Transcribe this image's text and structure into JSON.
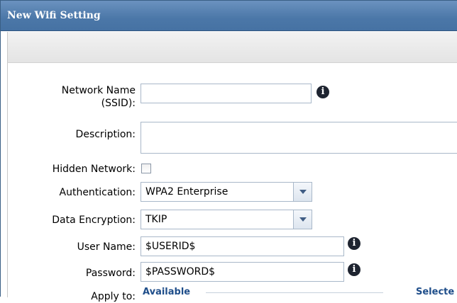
{
  "window": {
    "title": "New Wifi Setting"
  },
  "form": {
    "network_name": {
      "label": "Network Name",
      "label_line2": "(SSID):",
      "value": ""
    },
    "description": {
      "label": "Description:",
      "value": ""
    },
    "hidden_network": {
      "label": "Hidden Network:",
      "checked": false
    },
    "authentication": {
      "label": "Authentication:",
      "value": "WPA2 Enterprise"
    },
    "data_encryption": {
      "label": "Data Encryption:",
      "value": "TKIP"
    },
    "user_name": {
      "label": "User Name:",
      "value": "$USERID$"
    },
    "password": {
      "label": "Password:",
      "value": "$PASSWORD$"
    },
    "apply_to": {
      "label": "Apply to:",
      "available_legend": "Available",
      "selected_legend": "Selecte"
    }
  },
  "icons": {
    "info": "info-icon",
    "dropdown": "chevron-down-icon"
  },
  "colors": {
    "titlebar": "#4b77a8",
    "legend": "#1f4e8a"
  }
}
